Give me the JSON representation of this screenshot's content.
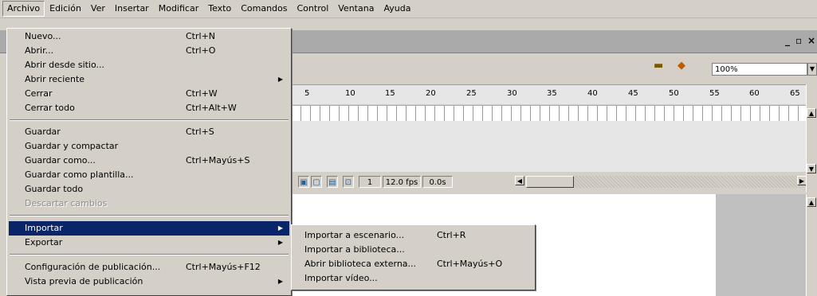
{
  "menubar": [
    "Archivo",
    "Edición",
    "Ver",
    "Insertar",
    "Modificar",
    "Texto",
    "Comandos",
    "Control",
    "Ventana",
    "Ayuda"
  ],
  "window_buttons": {
    "minimize": "_",
    "restore": "▫",
    "close": "×"
  },
  "toolbar": {
    "zoom": "100%",
    "scene_icon": "clapper-icon",
    "symbol_icon": "symbol-icon"
  },
  "ruler": [
    "5",
    "10",
    "15",
    "20",
    "25",
    "30",
    "35",
    "40",
    "45",
    "50",
    "55",
    "60",
    "65"
  ],
  "status": {
    "frame": "1",
    "fps": "12.0 fps",
    "time": "0.0s"
  },
  "archivo_menu": [
    {
      "label": "Nuevo...",
      "shortcut": "Ctrl+N"
    },
    {
      "label": "Abrir...",
      "shortcut": "Ctrl+O"
    },
    {
      "label": "Abrir desde sitio...",
      "shortcut": ""
    },
    {
      "label": "Abrir reciente",
      "shortcut": ""
    },
    {
      "label": "Cerrar",
      "shortcut": "Ctrl+W"
    },
    {
      "label": "Cerrar todo",
      "shortcut": "Ctrl+Alt+W"
    },
    {
      "label": "Guardar",
      "shortcut": "Ctrl+S"
    },
    {
      "label": "Guardar y compactar",
      "shortcut": ""
    },
    {
      "label": "Guardar como...",
      "shortcut": "Ctrl+Mayús+S"
    },
    {
      "label": "Guardar como plantilla...",
      "shortcut": ""
    },
    {
      "label": "Guardar todo",
      "shortcut": ""
    },
    {
      "label": "Descartar cambios",
      "shortcut": ""
    },
    {
      "label": "Importar",
      "shortcut": ""
    },
    {
      "label": "Exportar",
      "shortcut": ""
    },
    {
      "label": "Configuración de publicación...",
      "shortcut": "Ctrl+Mayús+F12"
    },
    {
      "label": "Vista previa de publicación",
      "shortcut": ""
    }
  ],
  "importar_submenu": [
    {
      "label": "Importar a escenario...",
      "shortcut": "Ctrl+R"
    },
    {
      "label": "Importar a biblioteca...",
      "shortcut": ""
    },
    {
      "label": "Abrir biblioteca externa...",
      "shortcut": "Ctrl+Mayús+O"
    },
    {
      "label": "Importar vídeo...",
      "shortcut": ""
    }
  ],
  "colors": {
    "highlight": "#0a246a",
    "face": "#d4d0c8",
    "titlebar": "#aaaaaa"
  }
}
